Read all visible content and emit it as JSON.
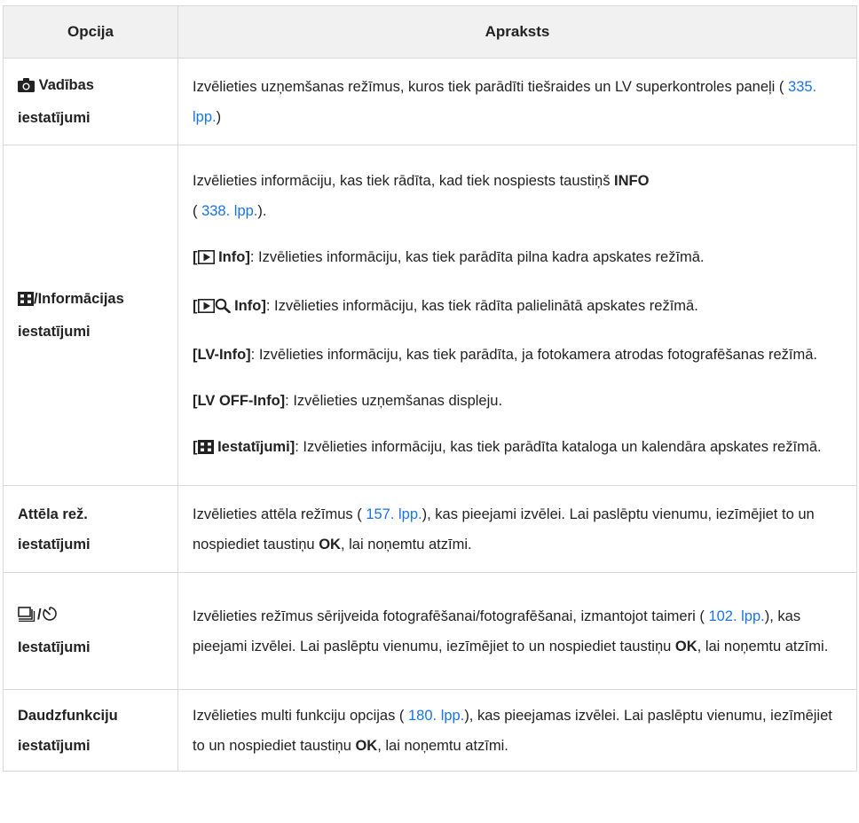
{
  "header": {
    "col_option": "Opcija",
    "col_description": "Apraksts"
  },
  "rows": {
    "control": {
      "label": "Vadības iestatījumi",
      "desc_before": "Izvēlieties uzņemšanas režīmus, kuros tiek parādīti tiešraides un LV superkontroles paneļi (",
      "link": " 335. lpp.",
      "desc_after": ")"
    },
    "info": {
      "label": "/Informācijas iestatījumi",
      "intro_before": "Izvēlieties informāciju, kas tiek rādīta, kad tiek nospiests taustiņš ",
      "intro_key": "INFO",
      "intro_mid": "(",
      "intro_link": " 338. lpp.",
      "intro_after": ").",
      "play_info_open": "[",
      "play_info_name": " Info]",
      "play_info_desc": ": Izvēlieties informāciju, kas tiek parādīta pilna kadra apskates režīmā.",
      "zoom_info_open": "[",
      "zoom_info_name": " Info]",
      "zoom_info_desc": ": Izvēlieties informāciju, kas tiek rādīta palielinātā apskates režīmā.",
      "lv_info_name": "[LV-Info]",
      "lv_info_desc": ": Izvēlieties informāciju, kas tiek parādīta, ja fotokamera atrodas fotografēšanas režīmā.",
      "lvoff_info_name": "[LV OFF-Info]",
      "lvoff_info_desc": ": Izvēlieties uzņemšanas displeju.",
      "index_open": "[",
      "index_name": " Iestatījumi]",
      "index_desc": ": Izvēlieties informāciju, kas tiek parādīta kataloga un kalendāra apskates režīmā."
    },
    "picture": {
      "label": "Attēla rež. iestatījumi",
      "desc_before": "Izvēlieties attēla režīmus (",
      "link": " 157. lpp.",
      "desc_mid": "), kas pieejami izvēlei. Lai paslēptu vienumu, iezīmējiet to un nospiediet taustiņu ",
      "key": "OK",
      "desc_after": ", lai noņemtu atzīmi."
    },
    "drive": {
      "label": "Iestatījumi",
      "desc_before": "Izvēlieties režīmus sērijveida fotografēšanai/fotografēšanai, izmantojot taimeri (",
      "link": " 102. lpp.",
      "desc_mid": "), kas pieejami izvēlei. Lai paslēptu vienumu, iezīmējiet to un nospiediet taustiņu ",
      "key": "OK",
      "desc_after": ", lai noņemtu atzīmi."
    },
    "multi": {
      "label": "Daudzfunkciju iestatījumi",
      "desc_before": "Izvēlieties multi funkciju opcijas (",
      "link": " 180. lpp.",
      "desc_mid": "), kas pieejamas izvēlei. Lai paslēptu vienumu, iezīmējiet to un nospiediet taustiņu ",
      "key": "OK",
      "desc_after": ", lai noņemtu atzīmi."
    }
  },
  "colors": {
    "link": "#1a73e8",
    "header_bg": "#f1f1f1",
    "border": "#d9d9d9"
  },
  "icons": [
    "camera-icon",
    "index-display-icon",
    "playback-icon",
    "magnify-icon",
    "sequential-shooting-icon",
    "self-timer-icon"
  ]
}
